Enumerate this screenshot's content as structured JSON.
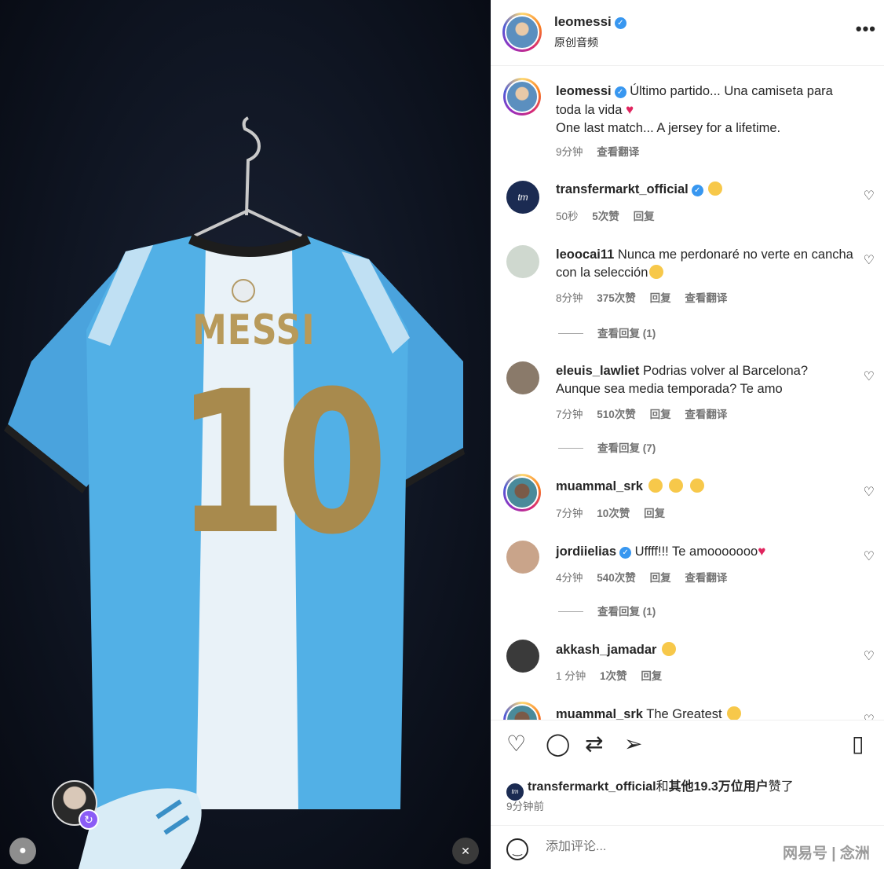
{
  "media": {
    "jersey_name": "MESSI",
    "jersey_number": "10",
    "icons": {
      "user_tag": "person-icon",
      "mute": "speaker-muted-icon",
      "remix": "remix-icon"
    }
  },
  "header": {
    "username": "leomessi",
    "audio_label": "原创音频",
    "more": "•••"
  },
  "caption": {
    "username": "leomessi",
    "line1": "Último partido... Una camiseta para toda la vida",
    "line2": "One last match... A jersey for a lifetime.",
    "time": "9分钟",
    "translate": "查看翻译"
  },
  "comments": [
    {
      "username": "transfermarkt_official",
      "text": "",
      "time": "50秒",
      "likes": "5次赞",
      "reply": "回复",
      "translate": ""
    },
    {
      "username": "leoocai11",
      "text": "Nunca me perdonaré no verte en cancha con la selección",
      "time": "8分钟",
      "likes": "375次赞",
      "reply": "回复",
      "translate": "查看翻译",
      "view_replies": "查看回复 (1)"
    },
    {
      "username": "eleuis_lawliet",
      "text": "Podrias volver al Barcelona? Aunque sea media temporada? Te amo",
      "time": "7分钟",
      "likes": "510次赞",
      "reply": "回复",
      "translate": "查看翻译",
      "view_replies": "查看回复 (7)"
    },
    {
      "username": "muammal_srk",
      "text": "",
      "time": "7分钟",
      "likes": "10次赞",
      "reply": "回复",
      "translate": ""
    },
    {
      "username": "jordiielias",
      "text": "Uffff!!! Te amooooooo",
      "time": "4分钟",
      "likes": "540次赞",
      "reply": "回复",
      "translate": "查看翻译",
      "view_replies": "查看回复 (1)"
    },
    {
      "username": "akkash_jamadar",
      "text": "",
      "time": "1 分钟",
      "likes": "1次赞",
      "reply": "回复",
      "translate": ""
    },
    {
      "username": "muammal_srk",
      "text": "The Greatest"
    }
  ],
  "actions": {
    "icons": [
      "heart-icon",
      "comment-icon",
      "repost-icon",
      "share-icon",
      "bookmark-icon"
    ],
    "liked_by_user": "transfermarkt_official",
    "liked_by_and": "和",
    "liked_by_others": "其他19.3万位用户",
    "liked_by_suffix": "赞了",
    "posted": "9分钟前"
  },
  "composer": {
    "placeholder": "添加评论...",
    "watermark": "网易号 | 念洲"
  },
  "colors": {
    "accent": "#3897f0",
    "text": "#262626",
    "muted": "#737373",
    "heart": "#e0245e"
  }
}
